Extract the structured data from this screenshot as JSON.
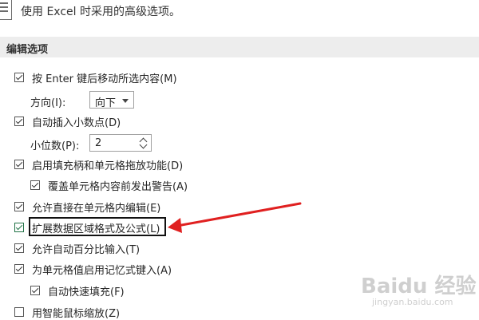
{
  "header": {
    "title": "使用 Excel 时采用的高级选项。"
  },
  "section": {
    "title": "编辑选项"
  },
  "options": [
    {
      "label": "按 Enter 键后移动所选内容(M)",
      "checked": true
    },
    {
      "label": "自动插入小数点(D)",
      "checked": true
    },
    {
      "label": "启用填充柄和单元格拖放功能(D)",
      "checked": true
    },
    {
      "label": "覆盖单元格内容前发出警告(A)",
      "checked": true
    },
    {
      "label": "允许直接在单元格内编辑(E)",
      "checked": true
    },
    {
      "label": "扩展数据区域格式及公式(L)",
      "checked": true
    },
    {
      "label": "允许自动百分比输入(T)",
      "checked": true
    },
    {
      "label": "为单元格值启用记忆式键入(A)",
      "checked": true
    },
    {
      "label": "自动快速填充(F)",
      "checked": true
    },
    {
      "label": "用智能鼠标缩放(Z)",
      "checked": false
    }
  ],
  "direction": {
    "label": "方向(I):",
    "value": "向下"
  },
  "decimals": {
    "label": "小位数(P):",
    "value": "2"
  },
  "watermark": {
    "line1": "Baidu 经验",
    "line2": "jingyan.baidu.com"
  },
  "annotation": {
    "arrow_color": "#e02020"
  }
}
